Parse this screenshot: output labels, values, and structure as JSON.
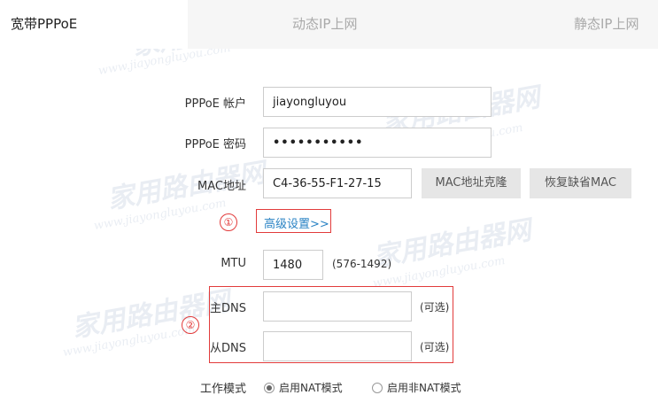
{
  "tabs": [
    {
      "label": "宽带PPPoE",
      "active": true
    },
    {
      "label": "动态IP上网",
      "active": false
    },
    {
      "label": "静态IP上网",
      "active": false
    }
  ],
  "form": {
    "pppoe_account_label": "PPPoE 帐户",
    "pppoe_account_value": "jiayongluyou",
    "pppoe_password_label": "PPPoE 密码",
    "pppoe_password_value": "•••••••••••",
    "mac_label": "MAC地址",
    "mac_value": "C4-36-55-F1-27-15",
    "mac_clone_button": "MAC地址克隆",
    "mac_restore_button": "恢复缺省MAC",
    "advanced_link": "高级设置>>",
    "mtu_label": "MTU",
    "mtu_value": "1480",
    "mtu_range": "(576-1492)",
    "primary_dns_label": "主DNS",
    "primary_dns_value": "",
    "primary_dns_hint": "(可选)",
    "secondary_dns_label": "从DNS",
    "secondary_dns_value": "",
    "secondary_dns_hint": "(可选)",
    "work_mode_label": "工作模式",
    "mode_nat": "启用NAT模式",
    "mode_non_nat": "启用非NAT模式",
    "selected_mode": "nat"
  },
  "annotations": {
    "marker_1": "①",
    "marker_2": "②"
  },
  "watermark": {
    "brand": "家用路由器网",
    "url": "www.jiayongluyou.com"
  },
  "colors": {
    "annotation_red": "#e23b3b",
    "link_blue": "#2a83c4"
  }
}
